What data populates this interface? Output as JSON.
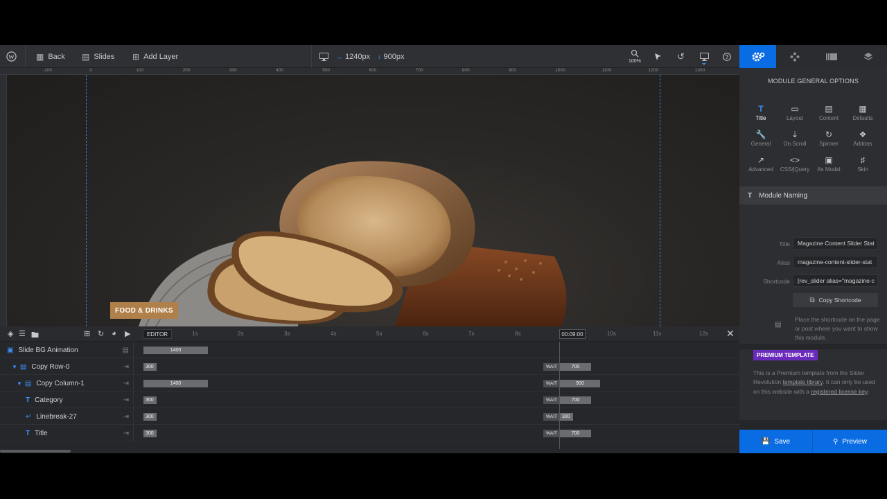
{
  "topbar": {
    "back_label": "Back",
    "slides_label": "Slides",
    "add_layer_label": "Add Layer",
    "width_value": "1240px",
    "height_value": "900px",
    "zoom_label": "100%"
  },
  "ruler": {
    "ticks": [
      "-100",
      "0",
      "100",
      "200",
      "300",
      "400",
      "500",
      "600",
      "700",
      "800",
      "900",
      "1000",
      "1100",
      "1200",
      "1300"
    ]
  },
  "canvas": {
    "category_label": "FOOD & DRINKS"
  },
  "timeline": {
    "editor_label": "EDITOR",
    "current_time": "00:09:00",
    "ticks": [
      "1s",
      "2s",
      "3s",
      "4s",
      "5s",
      "6s",
      "7s",
      "8s",
      "10s",
      "11s",
      "12s"
    ],
    "wait_label": "WAIT",
    "rows": [
      {
        "name": "Slide BG Animation",
        "bar": "1400",
        "wait": "",
        "end": ""
      },
      {
        "name": "Copy Row-0",
        "bar": "300",
        "wait": "WAIT",
        "end": "700"
      },
      {
        "name": "Copy Column-1",
        "bar": "1400",
        "wait": "WAIT",
        "end": "900"
      },
      {
        "name": "Category",
        "bar": "300",
        "wait": "WAIT",
        "end": "700"
      },
      {
        "name": "Linebreak-27",
        "bar": "300",
        "wait": "WAIT",
        "end": "300"
      },
      {
        "name": "Title",
        "bar": "300",
        "wait": "WAIT",
        "end": "700"
      }
    ]
  },
  "panel": {
    "title": "MODULE GENERAL OPTIONS",
    "options": [
      "Title",
      "Layout",
      "Content",
      "Defaults",
      "General",
      "On Scroll",
      "Spinner",
      "Addons",
      "Advanced",
      "CSS/jQuery",
      "As Modal",
      "Skin"
    ],
    "section_title": "Module Naming",
    "fields": {
      "title_label": "Title",
      "title_value": "Magazine Content Slider Stat",
      "alias_label": "Alias",
      "alias_value": "magazine-content-slider-stat",
      "shortcode_label": "Shortcode",
      "shortcode_value": "[rev_slider alias=\"magazine-c"
    },
    "copy_button": "Copy Shortcode",
    "hint": "Place the shortcode on the page or post where you want to show this module.",
    "premium_badge": "PREMIUM TEMPLATE",
    "premium_text_1": "This is a Premium template from the Slider Revolution ",
    "premium_link_1": "template library",
    "premium_text_2": ". It can only be used on this website with a ",
    "premium_link_2": "registered license key",
    "premium_text_3": "."
  },
  "actions": {
    "save_label": "Save",
    "preview_label": "Preview"
  },
  "colors": {
    "accent": "#0a6ce3",
    "category_tag": "#b0804a",
    "premium_badge": "#6a2bbd"
  }
}
